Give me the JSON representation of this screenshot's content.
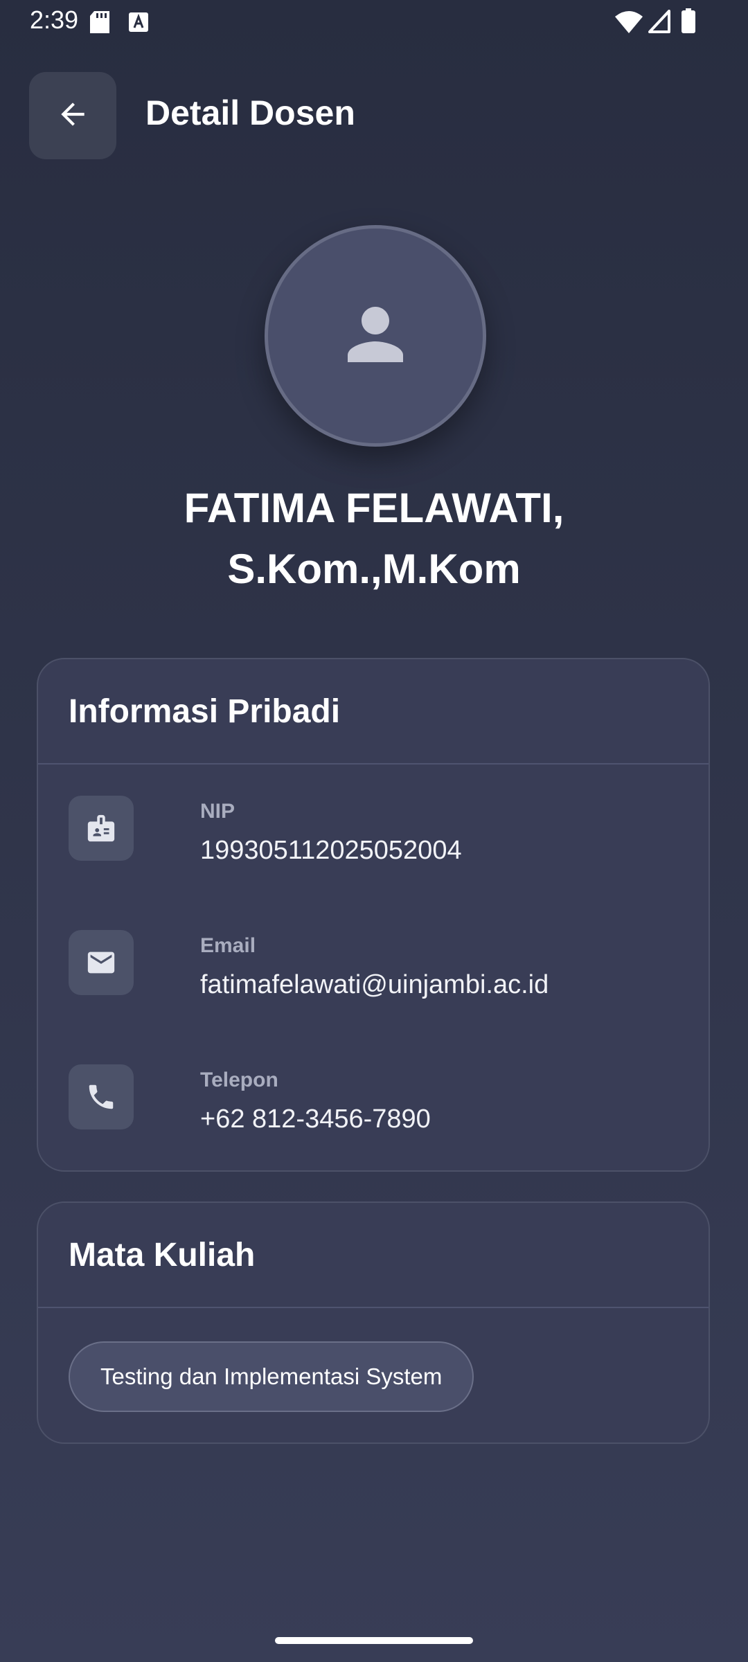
{
  "status_bar": {
    "time": "2:39",
    "icons": [
      "sd-card-icon",
      "keyboard-a-icon",
      "wifi-icon",
      "signal-icon",
      "battery-icon"
    ]
  },
  "header": {
    "back_icon": "arrow-left-icon",
    "title": "Detail Dosen"
  },
  "profile": {
    "avatar_icon": "person-icon",
    "name_line1": "FATIMA FELAWATI,",
    "name_line2": "S.Kom.,M.Kom"
  },
  "personal_info": {
    "title": "Informasi Pribadi",
    "items": [
      {
        "icon": "id-badge-icon",
        "label": "NIP",
        "value": "199305112025052004"
      },
      {
        "icon": "email-icon",
        "label": "Email",
        "value": "fatimafelawati@uinjambi.ac.id"
      },
      {
        "icon": "phone-icon",
        "label": "Telepon",
        "value": "+62 812-3456-7890"
      }
    ]
  },
  "courses": {
    "title": "Mata Kuliah",
    "items": [
      "Testing dan Implementasi System"
    ]
  },
  "colors": {
    "background": "#2f3449",
    "card": "#393d56",
    "icon_tile": "#4c5269",
    "label": "#a9adbf"
  }
}
